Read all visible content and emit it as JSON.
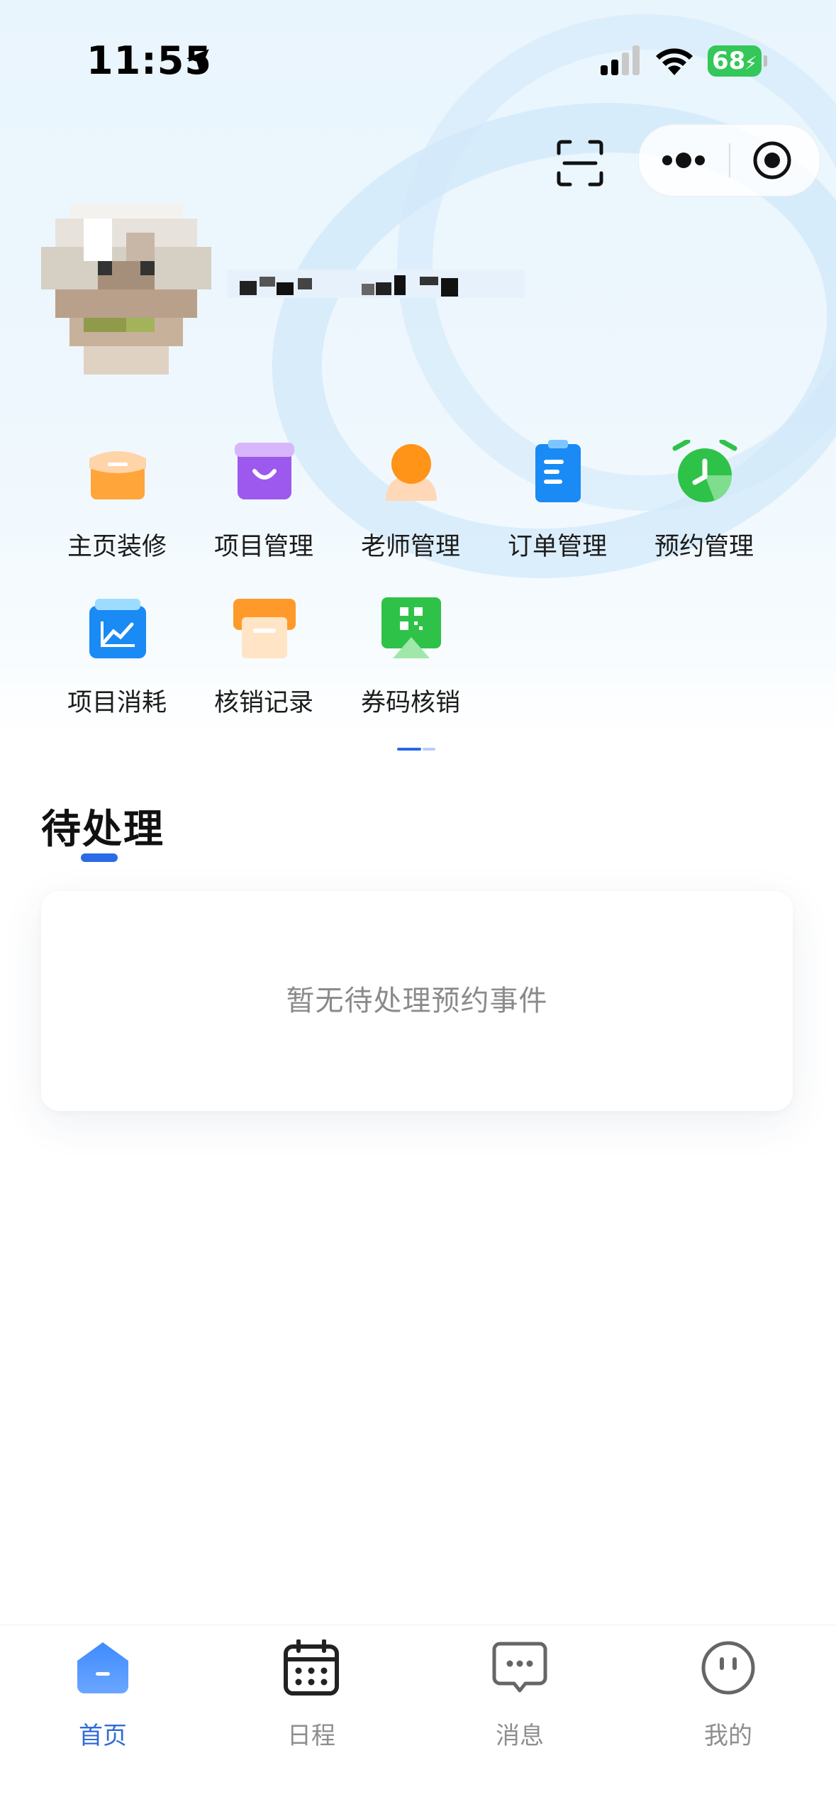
{
  "status_bar": {
    "time": "11:55",
    "battery": "68",
    "icons": [
      "location-arrow-icon",
      "cellular-signal-icon",
      "wifi-icon",
      "battery-charging-icon"
    ]
  },
  "header": {
    "icons": [
      "scan-icon",
      "more-dots-icon",
      "close-target-icon"
    ],
    "shop_name": "",
    "avatar": "avatar (pixelated)"
  },
  "menu": {
    "items": [
      {
        "label": "主页装修",
        "icon": "shop-decor-icon",
        "color": "#ff9b2e"
      },
      {
        "label": "项目管理",
        "icon": "project-bag-icon",
        "color": "#9b55ee"
      },
      {
        "label": "老师管理",
        "icon": "teacher-icon",
        "color": "#ff8f1a"
      },
      {
        "label": "订单管理",
        "icon": "order-clipboard-icon",
        "color": "#1c8cf5"
      },
      {
        "label": "预约管理",
        "icon": "alarm-clock-icon",
        "color": "#31c44a"
      },
      {
        "label": "项目消耗",
        "icon": "consumption-chart-icon",
        "color": "#1c8cf5"
      },
      {
        "label": "核销记录",
        "icon": "record-box-icon",
        "color": "#ff9b2e"
      },
      {
        "label": "券码核销",
        "icon": "qrcode-icon",
        "color": "#31c44a"
      }
    ]
  },
  "pending": {
    "title": "待处理",
    "empty_text": "暂无待处理预约事件"
  },
  "tab_bar": {
    "tabs": [
      {
        "label": "首页",
        "icon": "home-icon",
        "active": true
      },
      {
        "label": "日程",
        "icon": "calendar-icon",
        "active": false
      },
      {
        "label": "消息",
        "icon": "message-icon",
        "active": false
      },
      {
        "label": "我的",
        "icon": "profile-face-icon",
        "active": false
      }
    ],
    "accent": "#2f6bd8",
    "inactive": "#8e8e8e"
  }
}
